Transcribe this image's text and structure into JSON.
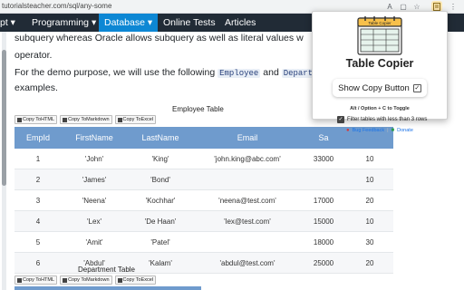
{
  "browser": {
    "url": "tutorialsteacher.com/sql/any-some"
  },
  "navbar": {
    "items": [
      {
        "label": "pt ▾"
      },
      {
        "label": "Programming ▾"
      },
      {
        "label": "Database ▾"
      },
      {
        "label": "Online Tests"
      },
      {
        "label": "Articles"
      }
    ]
  },
  "content": {
    "line1": "subquery whereas Oracle allows subquery as well as literal values w",
    "line2": "operator.",
    "line3_pre": "For the demo purpose, we will use the following ",
    "code1": "Employee",
    "line3_mid": " and ",
    "code2": "Depart",
    "line4": "examples."
  },
  "copy_buttons": {
    "html": "Copy ToHTML",
    "markdown": "Copy ToMarkdown",
    "excel": "Copy ToExcel"
  },
  "employee_table": {
    "caption": "Employee Table",
    "headers": [
      "EmpId",
      "FirstName",
      "LastName",
      "Email",
      "Sa",
      ""
    ],
    "rows": [
      [
        "1",
        "'John'",
        "'King'",
        "'john.king@abc.com'",
        "33000",
        "10"
      ],
      [
        "2",
        "'James'",
        "'Bond'",
        "",
        "",
        "10"
      ],
      [
        "3",
        "'Neena'",
        "'Kochhar'",
        "'neena@test.com'",
        "17000",
        "20"
      ],
      [
        "4",
        "'Lex'",
        "'De Haan'",
        "'lex@test.com'",
        "15000",
        "10"
      ],
      [
        "5",
        "'Amit'",
        "'Patel'",
        "",
        "18000",
        "30"
      ],
      [
        "6",
        "'Abdul'",
        "'Kalam'",
        "'abdul@test.com'",
        "25000",
        "20"
      ]
    ]
  },
  "department_table": {
    "caption": "Department Table"
  },
  "popup": {
    "title": "Table Copier",
    "logo_text": "Table Copier",
    "toggle_label": "Show Copy Button",
    "toggle_checked": true,
    "shortcut_hint": "Alt / Option + C to Toggle",
    "filter_label": "Filter tables with less than 3 rows",
    "filter_checked": true,
    "bug_feedback": "Bug Feedback",
    "donate": "Donate"
  }
}
